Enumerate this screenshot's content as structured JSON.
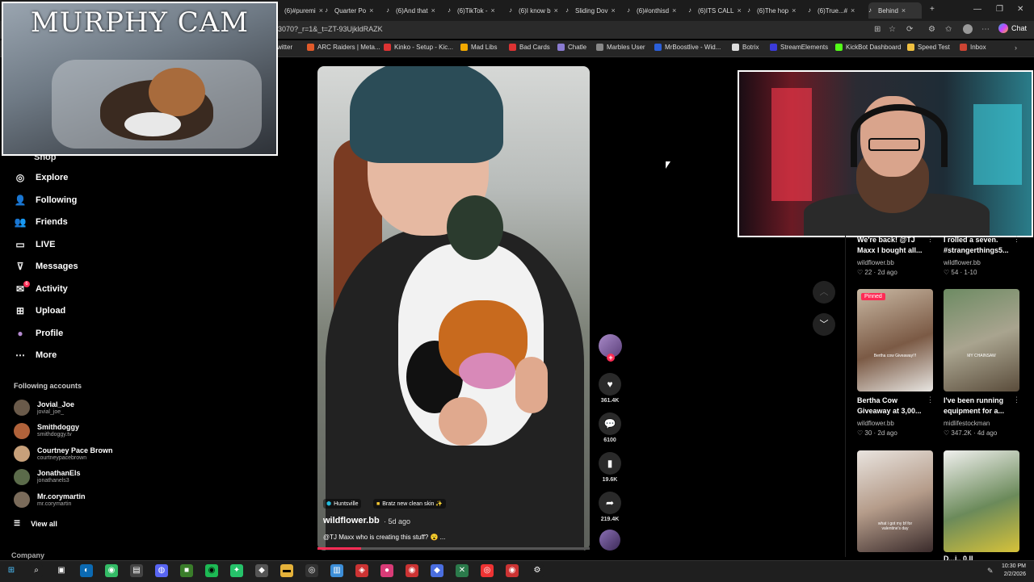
{
  "browser": {
    "tabs": [
      {
        "label": "(6)#puremi",
        "icon": "tiktok-icon"
      },
      {
        "label": "Quarter Po",
        "icon": "tiktok-icon"
      },
      {
        "label": "(6)And that",
        "icon": "tiktok-icon"
      },
      {
        "label": "(6)TikTok -",
        "icon": "tiktok-icon"
      },
      {
        "label": "(6)I know b",
        "icon": "tiktok-icon"
      },
      {
        "label": "Sliding Dov",
        "icon": "tiktok-icon"
      },
      {
        "label": "(6)#onthisd",
        "icon": "tiktok-icon"
      },
      {
        "label": "(6)ITS CALL",
        "icon": "tiktok-icon"
      },
      {
        "label": "(6)The hop",
        "icon": "tiktok-icon"
      },
      {
        "label": "(6)True...#",
        "icon": "tiktok-icon"
      },
      {
        "label": "Behind",
        "icon": "tiktok-icon",
        "active": true
      }
    ],
    "url": "3070?_r=1&_t=ZT-93UjkldRAZK",
    "chat_label": "Chat",
    "bookmarks": [
      {
        "label": "witter",
        "color": "#1d1d1d"
      },
      {
        "label": "ARC Raiders | Meta...",
        "color": "#e05a2a"
      },
      {
        "label": "Kinko - Setup - Kic...",
        "color": "#d33"
      },
      {
        "label": "Mad Libs",
        "color": "#f2a900"
      },
      {
        "label": "Bad Cards",
        "color": "#d33"
      },
      {
        "label": "Chatle",
        "color": "#8a7bd1"
      },
      {
        "label": "Marbles User",
        "color": "#888"
      },
      {
        "label": "MrBoostlive - Wid...",
        "color": "#2b5fd9"
      },
      {
        "label": "Botrix",
        "color": "#ddd"
      },
      {
        "label": "StreamElements",
        "color": "#3b3bd9"
      },
      {
        "label": "KickBot Dashboard",
        "color": "#53fc18"
      },
      {
        "label": "Speed Test",
        "color": "#f0c040"
      },
      {
        "label": "Inbox",
        "color": "#c43"
      }
    ]
  },
  "overlay": {
    "murphy_cam_title": "MURPHY CAM"
  },
  "sidebar": {
    "shop_partial": "Shop",
    "items": [
      {
        "label": "Explore",
        "icon": "compass-icon"
      },
      {
        "label": "Following",
        "icon": "following-icon"
      },
      {
        "label": "Friends",
        "icon": "friends-icon"
      },
      {
        "label": "LIVE",
        "icon": "live-icon"
      },
      {
        "label": "Messages",
        "icon": "messages-icon"
      },
      {
        "label": "Activity",
        "icon": "activity-icon"
      },
      {
        "label": "Upload",
        "icon": "upload-icon"
      },
      {
        "label": "Profile",
        "icon": "profile-icon"
      },
      {
        "label": "More",
        "icon": "more-icon"
      }
    ],
    "activity_badge": "6",
    "following_title": "Following accounts",
    "accounts": [
      {
        "name": "Jovial_Joe",
        "handle": "jovial_joe_",
        "color": "#6a5a4a"
      },
      {
        "name": "Smithdoggy",
        "handle": "smithdoggy.tv",
        "color": "#b0623a"
      },
      {
        "name": "Courtney Pace Brown",
        "handle": "courtneypacebrown",
        "color": "#c7a07a"
      },
      {
        "name": "JonathanEls",
        "handle": "jonathanels3",
        "color": "#5b6b4a"
      },
      {
        "name": "Mr.corymartin",
        "handle": "mr.corymartin",
        "color": "#7a6b5a"
      }
    ],
    "view_all": "View all",
    "company": "Company"
  },
  "video": {
    "location_tag": "Huntsville",
    "effect_tag": "Bratz new clean skin ✨",
    "author": "wildflower.bb",
    "when": "· 5d ago",
    "caption": "@TJ Maxx who is creating this stuff? 😮 ...",
    "progress": 0.16
  },
  "actions": {
    "likes": "361.4K",
    "comments": "6100",
    "saves": "19.6K",
    "shares": "219.4K"
  },
  "grid": {
    "top_row": [
      {
        "title": "We're back! @TJ Maxx I bought all...",
        "author": "wildflower.bb",
        "stats": "♡ 22 · 2d ago"
      },
      {
        "title": "I rolled a seven. #strangerthings5...",
        "author": "wildflower.bb",
        "stats": "♡ 54 · 1-10"
      }
    ],
    "middle_row": [
      {
        "pinned": "Pinned",
        "thumb_text": "Bertha cow Giveaway!!!",
        "title": "Bertha Cow Giveaway at 3,00...",
        "author": "wildflower.bb",
        "stats": "♡ 30 · 2d ago"
      },
      {
        "thumb_text": "MY CHAINSAW",
        "title": "I've been running equipment for a...",
        "author": "midlifestockman",
        "stats": "♡ 347.2K · 4d ago"
      }
    ],
    "bottom_row": [
      {
        "thumb_text": "what i got my bf for valentine's day"
      },
      {
        "title_partial": "D...i.. 0.II"
      }
    ]
  },
  "taskbar": {
    "time": "10:30 PM",
    "date": "2/2/2026"
  }
}
